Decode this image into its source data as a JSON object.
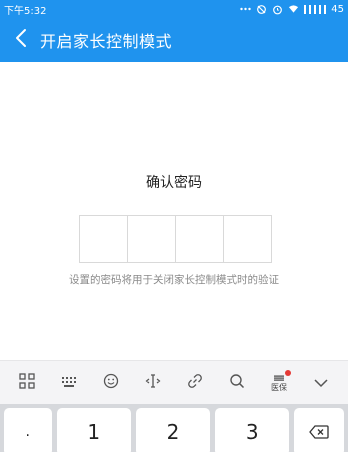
{
  "status": {
    "time": "下午5:32",
    "battery": "45"
  },
  "appbar": {
    "title": "开启家长控制模式"
  },
  "main": {
    "heading": "确认密码",
    "hint": "设置的密码将用于关闭家长控制模式时的验证"
  },
  "keyboard": {
    "toolbar": {
      "medical_label": "医保"
    },
    "keys": [
      ".",
      "1",
      "2",
      "3"
    ]
  },
  "colors": {
    "primary": "#1f93ee",
    "keyboard_bg": "#d6d8dc"
  }
}
